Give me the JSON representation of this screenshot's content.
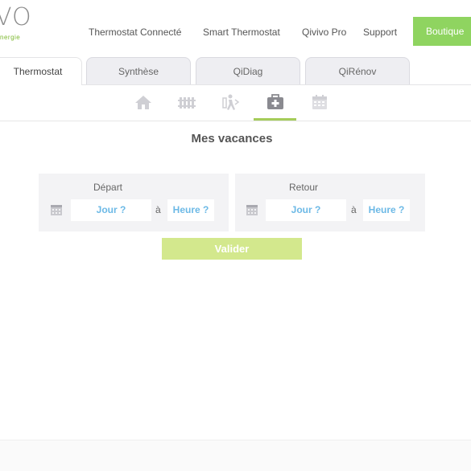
{
  "header": {
    "logo_text": "VO",
    "logo_sub": "nergie",
    "nav": [
      "Thermostat Connecté",
      "Smart Thermostat",
      "Qivivo Pro",
      "Support"
    ],
    "shop_label": "Boutique"
  },
  "tabs": [
    {
      "label": "Thermostat",
      "active": true
    },
    {
      "label": "Synthèse",
      "active": false
    },
    {
      "label": "QiDiag",
      "active": false
    },
    {
      "label": "QiRénov",
      "active": false
    }
  ],
  "icon_bar": {
    "items": [
      "home-icon",
      "radiator-icon",
      "person-leaving-icon",
      "suitcase-icon",
      "calendar-icon"
    ],
    "active": "suitcase-icon"
  },
  "main": {
    "title": "Mes vacances",
    "departure": {
      "label": "Départ",
      "day_placeholder": "Jour ?",
      "time_placeholder": "Heure ?",
      "at": "à"
    },
    "return": {
      "label": "Retour",
      "day_placeholder": "Jour ?",
      "time_placeholder": "Heure ?",
      "at": "à"
    },
    "validate_label": "Valider"
  },
  "colors": {
    "accent_green": "#8fd460",
    "active_underline": "#a5cc5a",
    "validate_bg": "#d3e88d",
    "placeholder_blue": "#6cb9e6"
  }
}
